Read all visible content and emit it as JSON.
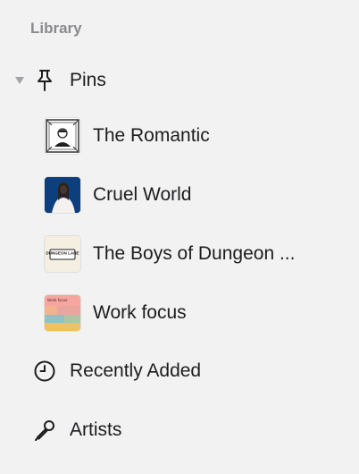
{
  "sidebar": {
    "section_title": "Library",
    "pins": {
      "label": "Pins",
      "items": [
        {
          "label": "The Romantic",
          "icon": "album-art-the-romantic"
        },
        {
          "label": "Cruel World",
          "icon": "album-art-cruel-world"
        },
        {
          "label": "The Boys of Dungeon ...",
          "icon": "album-art-the-boys-of-dungeon",
          "art_text": "DUNGEON LANE"
        },
        {
          "label": "Work focus",
          "icon": "playlist-art-work-focus",
          "art_text": "Work focus"
        }
      ]
    },
    "items": [
      {
        "label": "Recently Added",
        "icon": "clock-icon"
      },
      {
        "label": "Artists",
        "icon": "microphone-icon"
      }
    ]
  }
}
